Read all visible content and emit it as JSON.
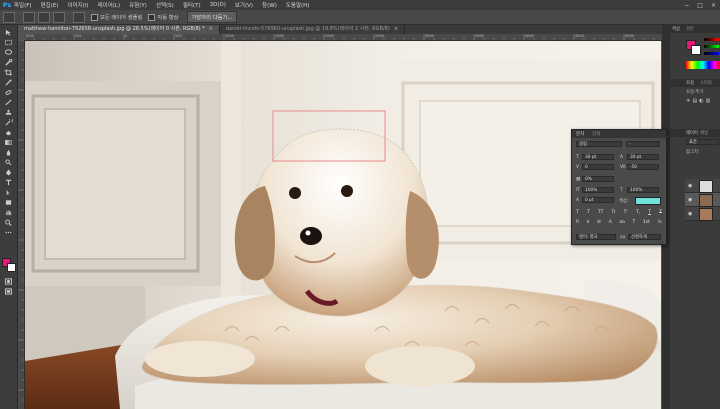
{
  "app": {
    "logo": "Ps",
    "menu": [
      "파일(F)",
      "편집(E)",
      "이미지(I)",
      "레이어(L)",
      "유형(Y)",
      "선택(S)",
      "필터(T)",
      "3D(D)",
      "보기(V)",
      "창(W)",
      "도움말(H)"
    ],
    "window_controls": [
      "−",
      "□",
      "×"
    ]
  },
  "options_bar": {
    "sample_all_layers": "모든 레이어 샘플링",
    "auto_enhance": "자동 향상",
    "refine_edge": "가장자리 다듬기..."
  },
  "tabs": [
    {
      "label": "matthew-hamilton-792658-unsplash.jpg @ 28.5%(레이어 0 사본, RGB/8) *",
      "active": true
    },
    {
      "label": "daniel-lincoln-578960-unsplash.jpg @ 19.8%(레이어 2 사본, RGB/8)",
      "active": false
    }
  ],
  "ruler": {
    "ticks": [
      "1000",
      "500",
      "0",
      "500",
      "1000",
      "1500",
      "2000",
      "2500",
      "3000",
      "3500",
      "4000",
      "4500",
      "5000",
      "5500",
      "6000"
    ]
  },
  "character_panel": {
    "tabs": [
      "문자",
      "단락"
    ],
    "font_family": "굴림",
    "font_style": "-",
    "font_size": "30 pt",
    "leading": "30 pt",
    "kerning": "0",
    "tracking": "-50",
    "vertical_scale_pct": "0%",
    "horizontal_scale": "100%",
    "vertical_scale": "100%",
    "baseline": "0 pt",
    "color_label": "색상:",
    "color": "#6fe3da",
    "type_buttons": [
      "T",
      "T",
      "TT",
      "Tr",
      "T'",
      "T,",
      "T",
      "T"
    ],
    "bottom_buttons": [
      "fi",
      "σ",
      "st",
      "A",
      "aa",
      "T",
      "1st",
      "½"
    ],
    "language": "영어: 영국",
    "antialias_prefix": "aa",
    "antialias": "선명하게"
  },
  "right_dock": {
    "panel_labels": [
      "색상",
      "견본",
      "조정",
      "스타일",
      "조정 추가",
      "레이어",
      "채널",
      "경로"
    ],
    "blend_mode": "표준",
    "lock_label": "잠그기:"
  },
  "colors": {
    "foreground": "#e2197b",
    "background": "#ffffff",
    "selection": "#e88a8a"
  }
}
